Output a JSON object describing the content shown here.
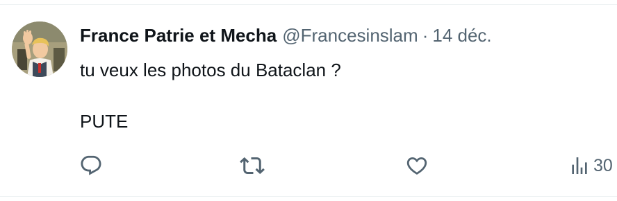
{
  "tweet": {
    "display_name": "France Patrie et Mecha",
    "handle": "@Francesinslam",
    "separator": "·",
    "date": "14 déc.",
    "text_line1": "tu veux les photos du Bataclan ?",
    "text_line2": "PUTE"
  },
  "actions": {
    "reply_icon": "reply-icon",
    "retweet_icon": "retweet-icon",
    "like_icon": "heart-icon",
    "views_icon": "bar-chart-icon",
    "views_count": "30"
  },
  "colors": {
    "text_primary": "#0f1419",
    "text_secondary": "#536471",
    "border": "#eff3f4"
  }
}
